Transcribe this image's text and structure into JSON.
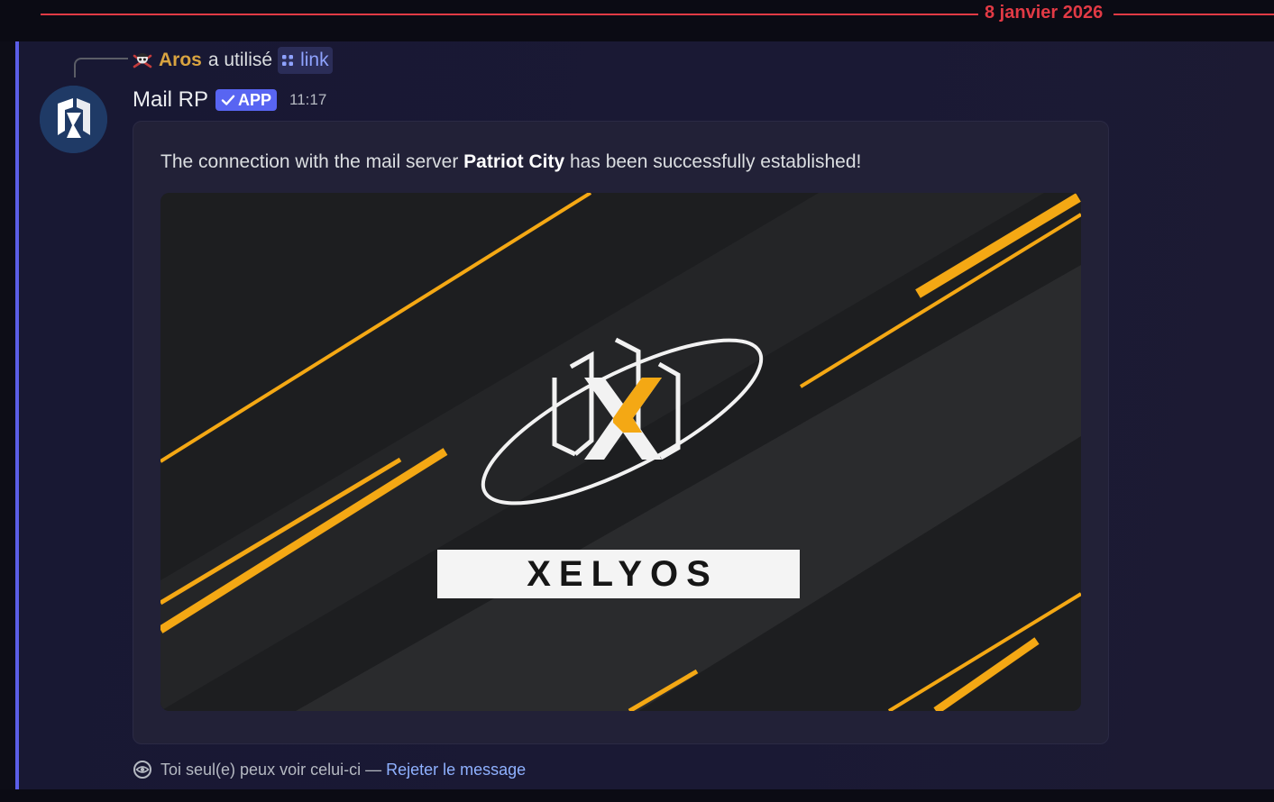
{
  "date_divider": {
    "text": "8 janvier 2026"
  },
  "reply": {
    "user_icon": "pirate-skull-icon",
    "username": "Aros",
    "verb": "a utilisé",
    "command_icon": "slash-command-icon",
    "command": "link"
  },
  "message": {
    "avatar_icon": "xelyos-logo-icon",
    "author": "Mail RP",
    "badge": "APP",
    "badge_icon": "check-icon",
    "timestamp": "11:17",
    "description_parts": {
      "before": "The connection with the mail server ",
      "bold": "Patriot City",
      "after": " has been successfully established!"
    },
    "image": {
      "brand": "XELYOS"
    }
  },
  "footer": {
    "icon": "eye-icon",
    "note": "Toi seul(e) peux voir celui-ci —",
    "dismiss": "Rejeter le message"
  },
  "colors": {
    "accent_blurple": "#5865f2",
    "date_red": "#e23a45",
    "username_gold": "#d9a440",
    "link_blue": "#8fb1ff",
    "brand_orange": "#f4a814"
  }
}
